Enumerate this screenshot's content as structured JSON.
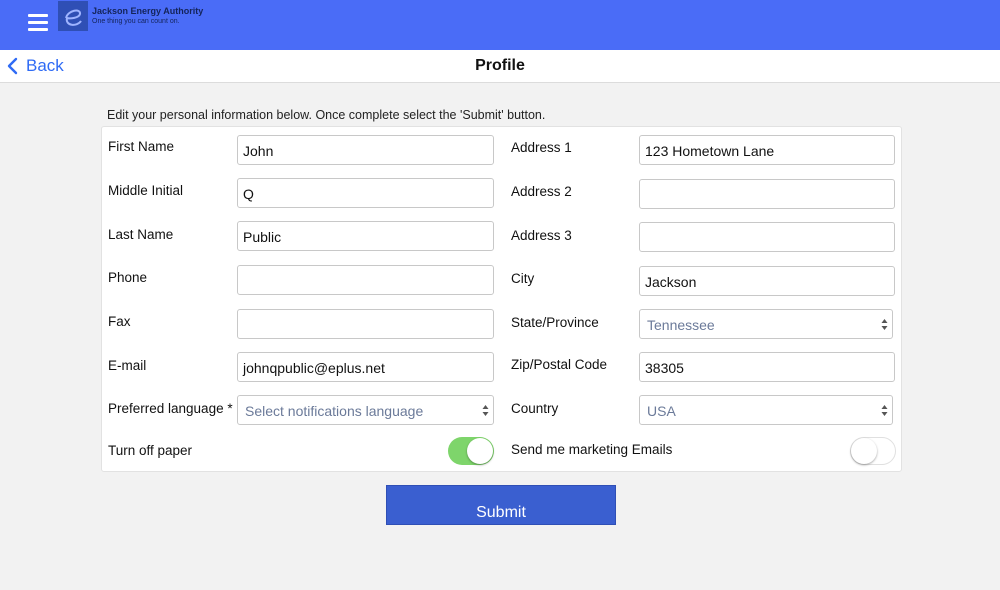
{
  "header": {
    "logo_title": "Jackson Energy Authority",
    "logo_tagline": "One thing you can count on."
  },
  "nav": {
    "back_label": "Back",
    "page_title": "Profile"
  },
  "instructions": "Edit your personal information below. Once complete select the 'Submit' button.",
  "left_fields": [
    {
      "label": "First Name",
      "value": "John"
    },
    {
      "label": "Middle Initial",
      "value": "Q"
    },
    {
      "label": "Last Name",
      "value": "Public"
    },
    {
      "label": "Phone",
      "value": ""
    },
    {
      "label": "Fax",
      "value": ""
    },
    {
      "label": "E-mail",
      "value": "johnqpublic@eplus.net"
    }
  ],
  "right_fields": [
    {
      "label": "Address 1",
      "value": "123 Hometown Lane"
    },
    {
      "label": "Address 2",
      "value": ""
    },
    {
      "label": "Address 3",
      "value": ""
    },
    {
      "label": "City",
      "value": "Jackson"
    },
    {
      "label": "State/Province",
      "value": "Tennessee"
    },
    {
      "label": "Zip/Postal Code",
      "value": "38305"
    },
    {
      "label": "Country",
      "value": "USA"
    }
  ],
  "preferred_language": {
    "label": "Preferred language *",
    "placeholder": "Select notifications language"
  },
  "toggles": {
    "paper_label": "Turn off paper",
    "paper_on": true,
    "marketing_label": "Send me marketing Emails",
    "marketing_on": false
  },
  "submit_label": "Submit",
  "colors": {
    "header_bg": "#4a6cf7",
    "back_link": "#2f6bf5",
    "toggle_on": "#7ed56b",
    "submit_bg": "#3a5fd0"
  }
}
